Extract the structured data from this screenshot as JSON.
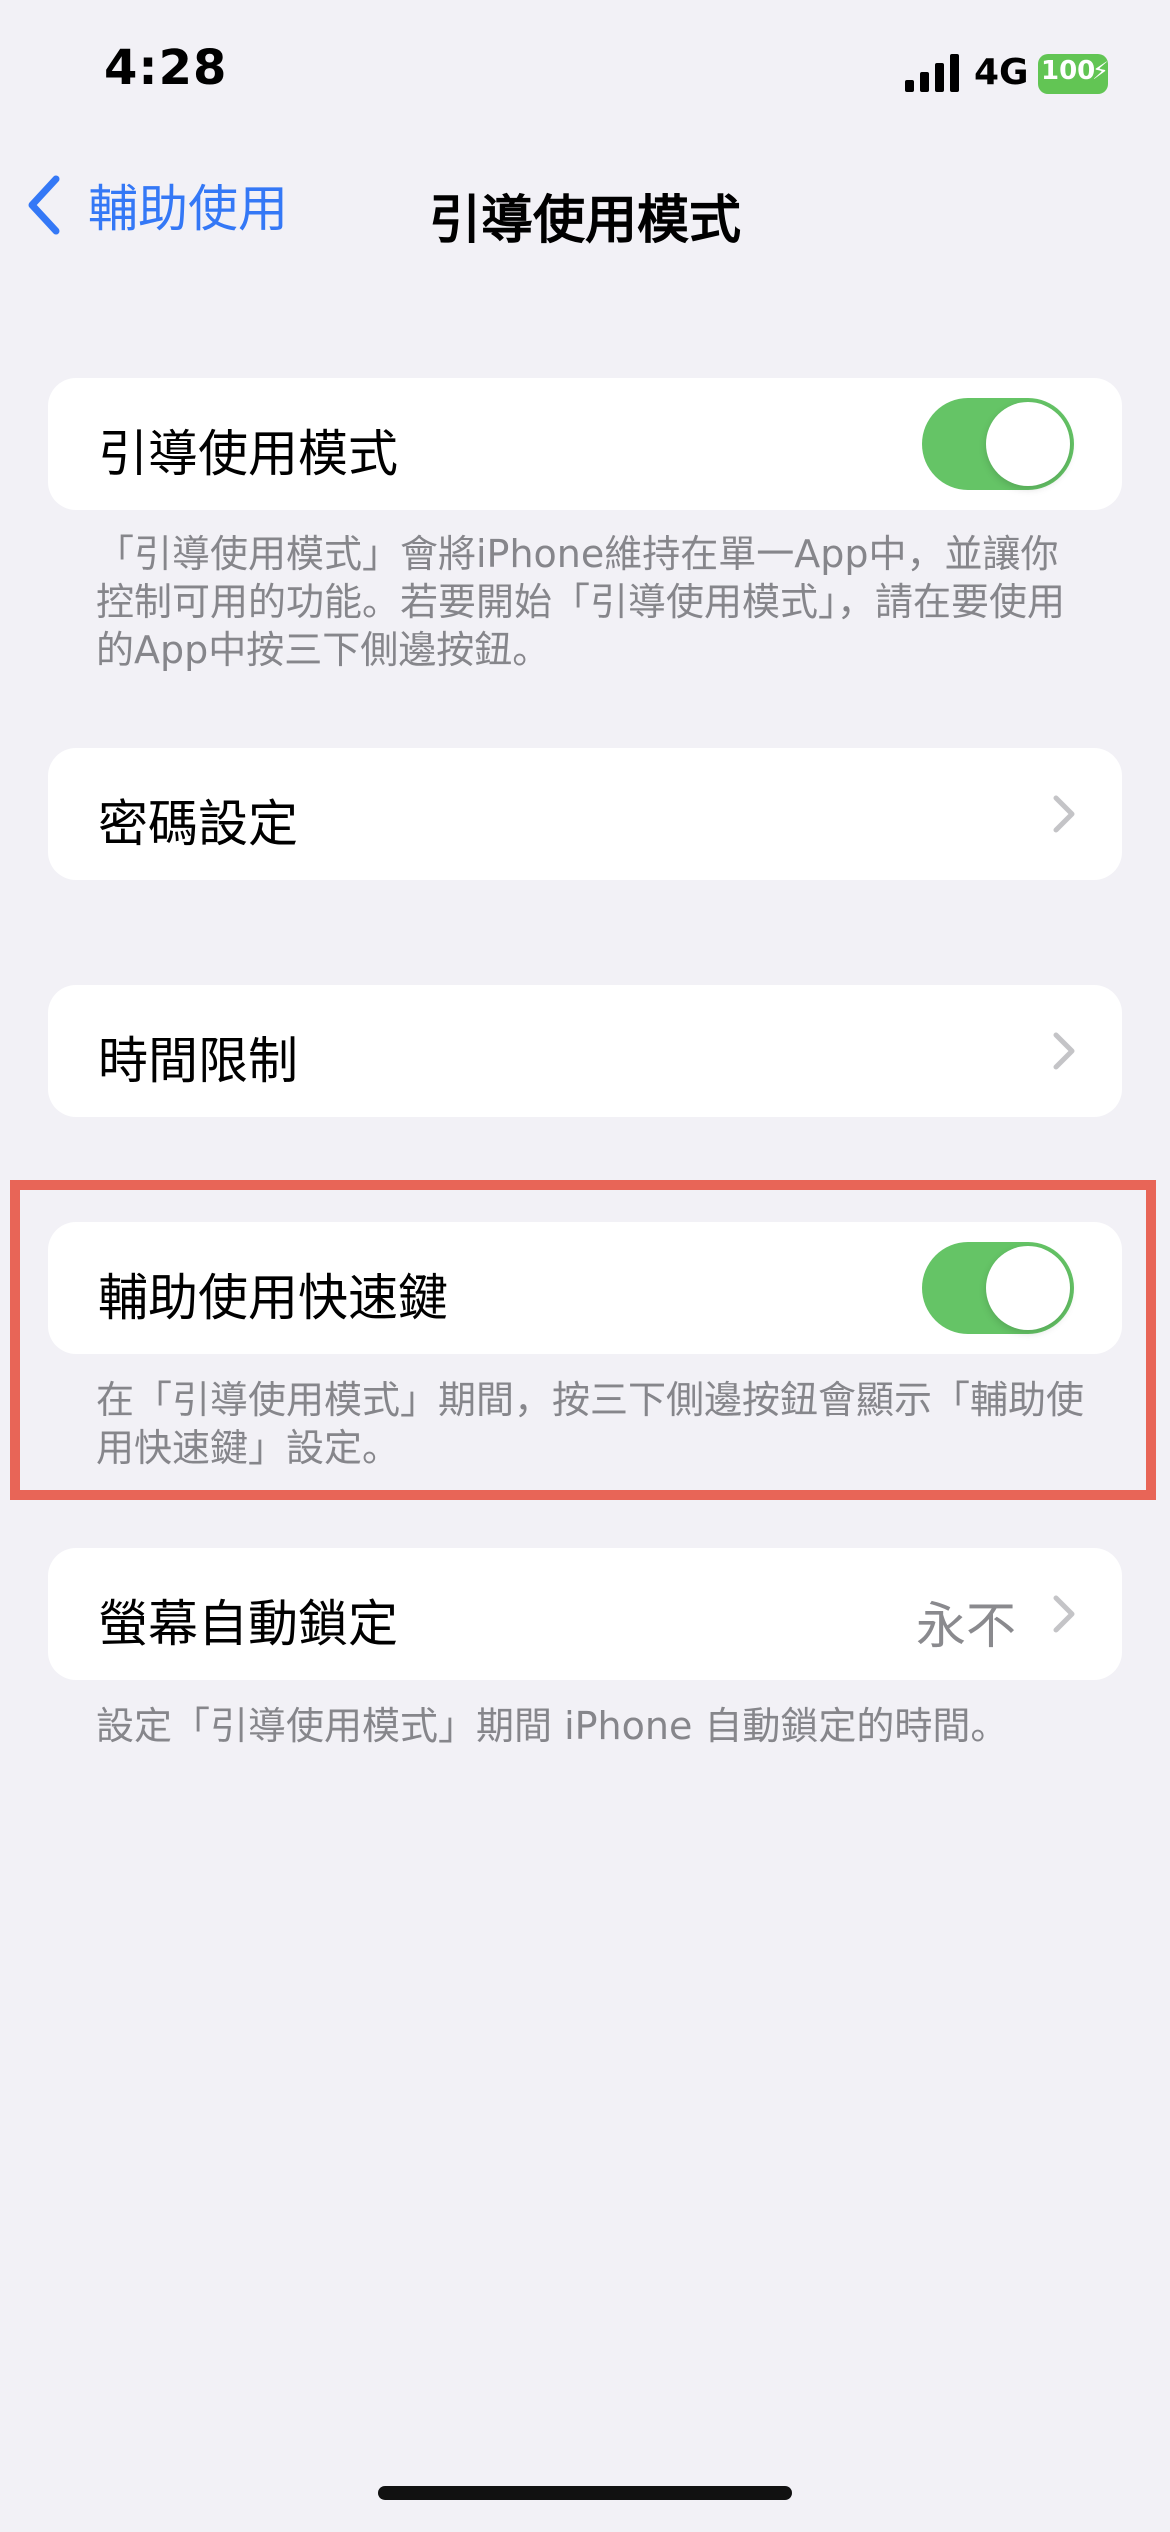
{
  "status_bar": {
    "time": "4:28",
    "network": "4G",
    "battery": "100",
    "battery_color": "#62C554"
  },
  "nav": {
    "back_label": "輔助使用",
    "title": "引導使用模式",
    "accent": "#3478F6"
  },
  "sections": {
    "guided_access": {
      "label": "引導使用模式",
      "toggle_on": true,
      "footer": "「引導使用模式」會將iPhone維持在單一App中，並讓你控制可用的功能。若要開始「引導使用模式」，請在要使用的App中按三下側邊按鈕。"
    },
    "passcode": {
      "label": "密碼設定"
    },
    "time_limits": {
      "label": "時間限制"
    },
    "accessibility_shortcut": {
      "label": "輔助使用快速鍵",
      "toggle_on": true,
      "footer": "在「引導使用模式」期間，按三下側邊按鈕會顯示「輔助使用快速鍵」設定。"
    },
    "auto_lock": {
      "label": "螢幕自動鎖定",
      "value": "永不",
      "footer": "設定「引導使用模式」期間 iPhone 自動鎖定的時間。"
    }
  },
  "colors": {
    "toggle_on": "#65C466",
    "highlight_border": "#E86557",
    "background": "#F2F1F6"
  }
}
